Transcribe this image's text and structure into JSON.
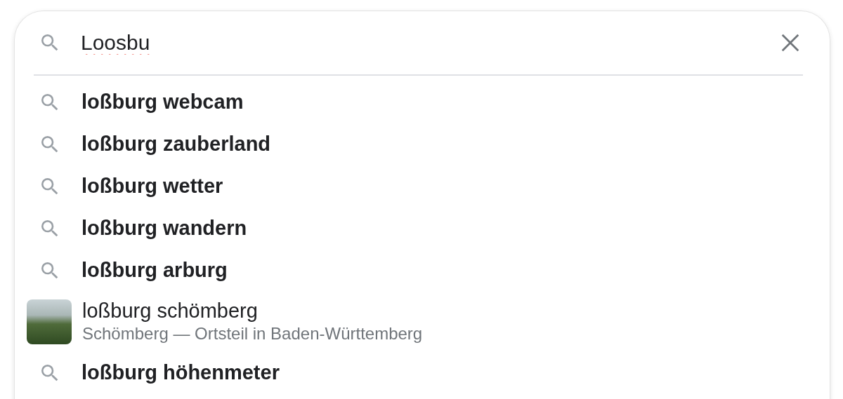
{
  "search": {
    "value": "Loosbu",
    "misspelled": true
  },
  "suggestions": [
    {
      "kind": "query",
      "text": "loßburg webcam"
    },
    {
      "kind": "query",
      "text": "loßburg zauberland"
    },
    {
      "kind": "query",
      "text": "loßburg wetter"
    },
    {
      "kind": "query",
      "text": "loßburg wandern"
    },
    {
      "kind": "query",
      "text": "loßburg arburg"
    },
    {
      "kind": "entity",
      "text": "loßburg schömberg",
      "subtitle": "Schömberg — Ortsteil in Baden-Württemberg"
    },
    {
      "kind": "query",
      "text": "loßburg höhenmeter"
    }
  ]
}
